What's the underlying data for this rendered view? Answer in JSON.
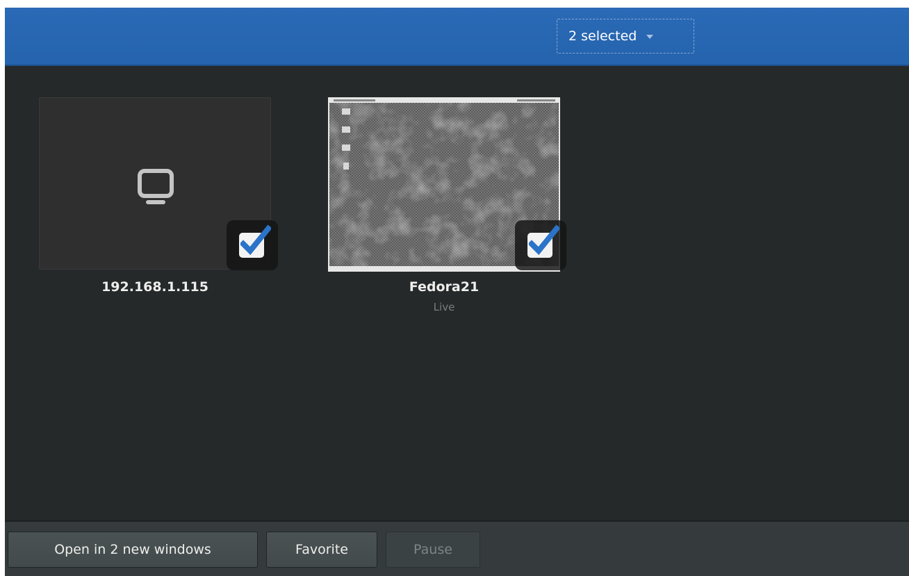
{
  "header": {
    "selection_label": "2 selected"
  },
  "collection": {
    "items": [
      {
        "name": "192.168.1.115",
        "status": "",
        "selected": true,
        "thumbnail": "monitor-icon"
      },
      {
        "name": "Fedora21",
        "status": "Live",
        "selected": true,
        "thumbnail": "desktop-screenshot"
      }
    ]
  },
  "actionbar": {
    "open_label": "Open in 2 new windows",
    "favorite_label": "Favorite",
    "pause_label": "Pause"
  },
  "colors": {
    "header_blue": "#2a6ab6",
    "content_bg": "#25292a",
    "check_blue": "#2b73c8"
  }
}
